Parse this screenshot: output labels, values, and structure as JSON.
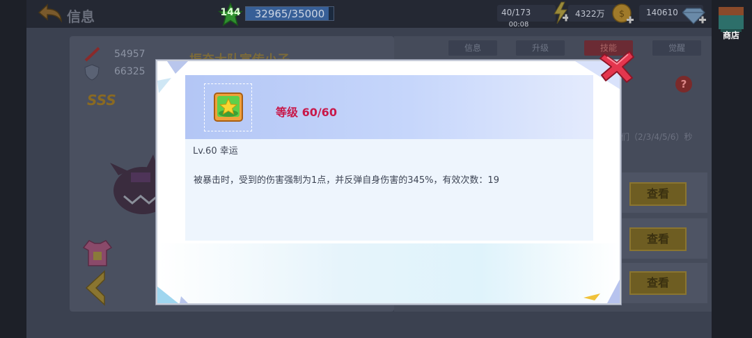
{
  "header": {
    "title": "信息",
    "player_level": "144",
    "exp_text": "32965/35000",
    "exp_progress": 0.942
  },
  "resources": {
    "stamina": "40/173",
    "stamina_timer": "00:08",
    "gold": "4322万",
    "gems": "140610",
    "shop_label": "商店"
  },
  "hero": {
    "attack": "54957",
    "defense": "66325",
    "rank": "SSS",
    "name": "振奋大队宣传小子"
  },
  "tabs": [
    {
      "label": "信息",
      "active": false
    },
    {
      "label": "升级",
      "active": false
    },
    {
      "label": "技能",
      "active": true
    },
    {
      "label": "觉醒",
      "active": false
    }
  ],
  "side_panel": {
    "text": "们（2/3/4/5/6）秒",
    "view_label": "查看"
  },
  "modal": {
    "level_label": "等级  60/60",
    "skill_name": "Lv.60 幸运",
    "description": "被暴击时，受到的伤害强制为1点，并反弹自身伤害的345%，有效次数：19"
  },
  "colors": {
    "accent_red": "#c8194a",
    "header_band": "#b3c6f5",
    "close_red": "#e4364e"
  },
  "icons": {
    "back": "back-arrow-icon",
    "level": "star-icon",
    "stamina": "lightning-icon",
    "gold": "coin-icon",
    "gem": "diamond-icon",
    "shop": "shop-icon",
    "skill": "clover-icon",
    "close": "close-icon"
  }
}
